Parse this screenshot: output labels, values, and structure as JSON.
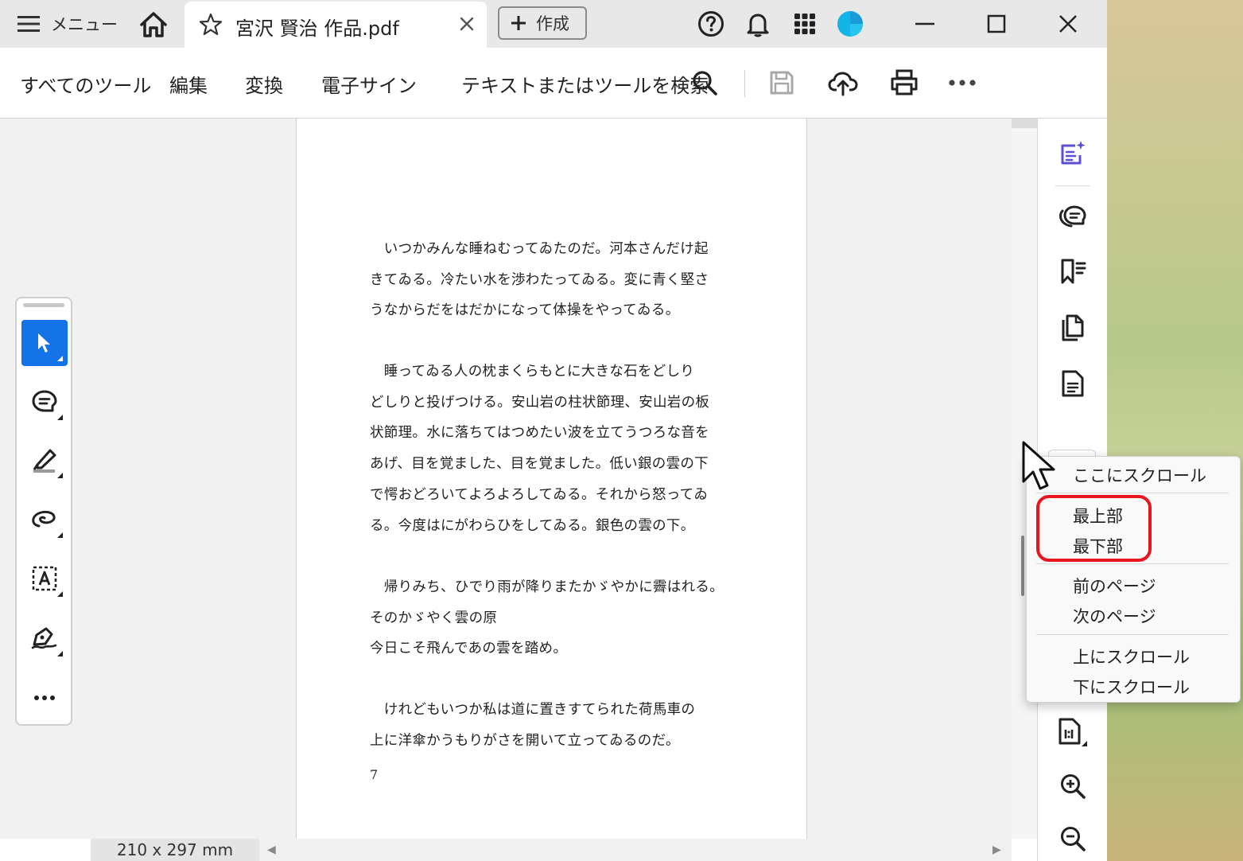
{
  "titlebar": {
    "menu_label": "メニュー",
    "tab_title": "宮沢 賢治 作品.pdf",
    "create_label": "作成"
  },
  "toolbar": {
    "all_tools": "すべてのツール",
    "edit": "編集",
    "convert": "変換",
    "esign": "電子サイン",
    "search_placeholder": "テキストまたはツールを検索"
  },
  "document": {
    "paragraphs": [
      "　いつかみんな睡ねむってゐたのだ。河本さんだけ起\nきてゐる。冷たい水を渉わたってゐる。変に青く堅さ\nうなからだをはだかになって体操をやってゐる。",
      "　睡ってゐる人の枕まくらもとに大きな石をどしり\nどしりと投げつける。安山岩の柱状節理、安山岩の板\n状節理。水に落ちてはつめたい波を立てうつろな音を\nあげ、目を覚ました、目を覚ました。低い銀の雲の下\nで愕おどろいてよろよろしてゐる。それから怒ってゐ\nる。今度はにがわらひをしてゐる。銀色の雲の下。",
      "　帰りみち、ひでり雨が降りまたかゞやかに霽はれる。\nそのかゞやく雲の原\n今日こそ飛んであの雲を踏め。",
      "　けれどもいつか私は道に置きすてられた荷馬車の\n上に洋傘かうもりがさを開いて立ってゐるのだ。"
    ],
    "page_number": "7"
  },
  "status": {
    "page_size": "210 x 297 mm"
  },
  "context_menu": {
    "scroll_here": "ここにスクロール",
    "top": "最上部",
    "bottom": "最下部",
    "prev_page": "前のページ",
    "next_page": "次のページ",
    "scroll_up": "上にスクロール",
    "scroll_down": "下にスクロール"
  },
  "colors": {
    "accent": "#1473e6",
    "highlight": "#e8141e",
    "ai_icon": "#5b4fd6"
  }
}
